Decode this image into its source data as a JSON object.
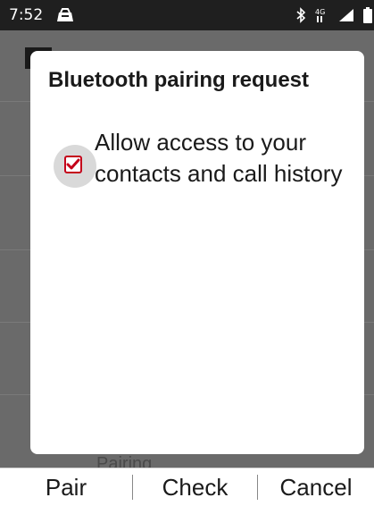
{
  "status_bar": {
    "time": "7:52",
    "network_label": "4G"
  },
  "background": {
    "list_item_partial": "Pairing"
  },
  "dialog": {
    "title": "Bluetooth pairing request",
    "checkbox_checked": true,
    "checkbox_label": "Allow access to your contacts and call history"
  },
  "softkeys": {
    "left": "Pair",
    "center": "Check",
    "right": "Cancel"
  },
  "colors": {
    "accent": "#c4001a",
    "statusbar": "#1f1f1f",
    "dim_background": "#6a6a6a"
  }
}
